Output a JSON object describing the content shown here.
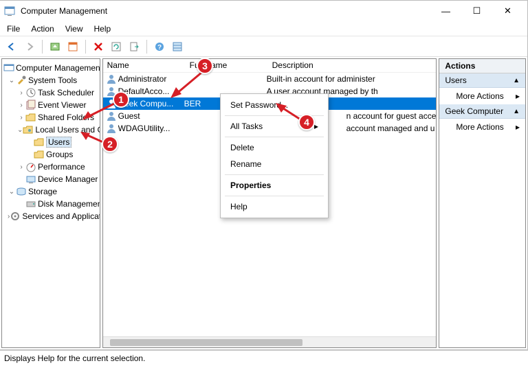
{
  "window": {
    "title": "Computer Management"
  },
  "menubar": {
    "file": "File",
    "action": "Action",
    "view": "View",
    "help": "Help"
  },
  "tree": {
    "root": "Computer Management (Local)",
    "system_tools": "System Tools",
    "task_scheduler": "Task Scheduler",
    "event_viewer": "Event Viewer",
    "shared_folders": "Shared Folders",
    "local_users": "Local Users and Groups",
    "users": "Users",
    "groups": "Groups",
    "performance": "Performance",
    "device_manager": "Device Manager",
    "storage": "Storage",
    "disk_management": "Disk Management",
    "services_apps": "Services and Applications"
  },
  "list": {
    "cols": {
      "name": "Name",
      "fullname": "Full Name",
      "desc": "Description"
    },
    "rows": [
      {
        "name": "Administrator",
        "fullname": "",
        "desc": "Built-in account for administer"
      },
      {
        "name": "DefaultAcco...",
        "fullname": "",
        "desc": "A user account managed by th"
      },
      {
        "name": "Geek Compu...",
        "fullname": "BER",
        "desc": ""
      },
      {
        "name": "Guest",
        "fullname": "",
        "desc": "n account for guest acce"
      },
      {
        "name": "WDAGUtility...",
        "fullname": "",
        "desc": "account managed and u"
      }
    ]
  },
  "ctx": {
    "set_password": "Set Password...",
    "all_tasks": "All Tasks",
    "delete": "Delete",
    "rename": "Rename",
    "properties": "Properties",
    "help": "Help"
  },
  "actions": {
    "header": "Actions",
    "cat1": "Users",
    "more1": "More Actions",
    "cat2": "Geek Computer",
    "more2": "More Actions"
  },
  "status": "Displays Help for the current selection.",
  "badges": {
    "b1": "1",
    "b2": "2",
    "b3": "3",
    "b4": "4"
  }
}
